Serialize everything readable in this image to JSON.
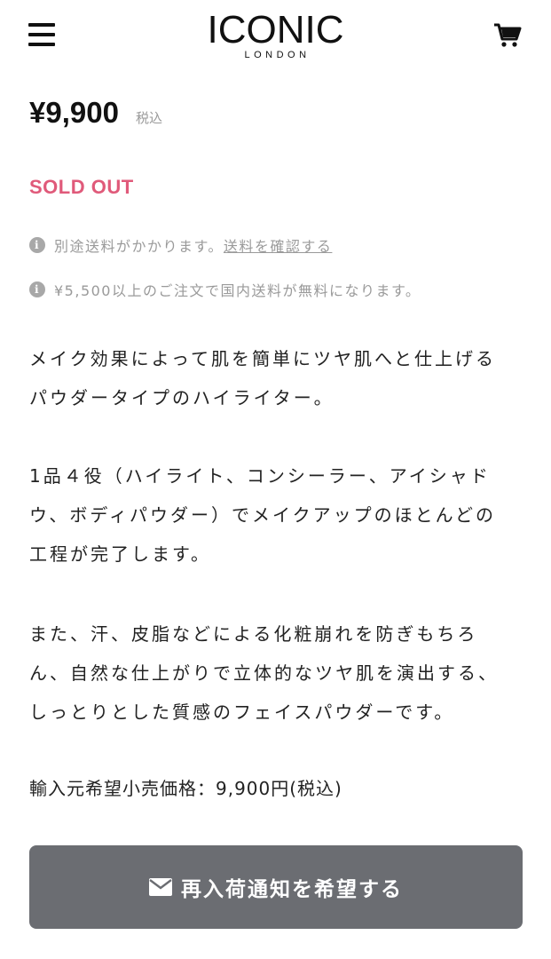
{
  "header": {
    "brand": "ICONIC",
    "brand_sub": "LONDON"
  },
  "product": {
    "price": "¥9,900",
    "tax_label": "税込",
    "status": "SOLD OUT"
  },
  "shipping_notes": {
    "note1_text": "別途送料がかかります。",
    "note1_link": "送料を確認する",
    "note2_text": "¥5,500以上のご注文で国内送料が無料になります。"
  },
  "description": {
    "p1_line1": "メイク効果によって肌を簡単にツヤ肌へと仕上げる",
    "p1_line2": "パウダータイプのハイライター。",
    "p2_line1": "1品４役（ハイライト、コンシーラー、アイシャド",
    "p2_line2": "ウ、ボディパウダー）でメイクアップのほとんどの",
    "p2_line3": "工程が完了します。",
    "p3_line1": "また、汗、皮脂などによる化粧崩れを防ぎもちろ",
    "p3_line2": "ん、自然な仕上がりで立体的なツヤ肌を演出する、",
    "p3_line3": "しっとりとした質感のフェイスパウダーです。",
    "msrp": "輸入元希望小売価格：9,900円(税込)"
  },
  "actions": {
    "notify_label": "再入荷通知を希望する"
  },
  "colors": {
    "soldout": "#e05a7a",
    "button": "#6b6d72"
  },
  "icons": {
    "menu": "hamburger-icon",
    "cart": "cart-icon",
    "info": "info-icon",
    "mail": "mail-icon"
  }
}
